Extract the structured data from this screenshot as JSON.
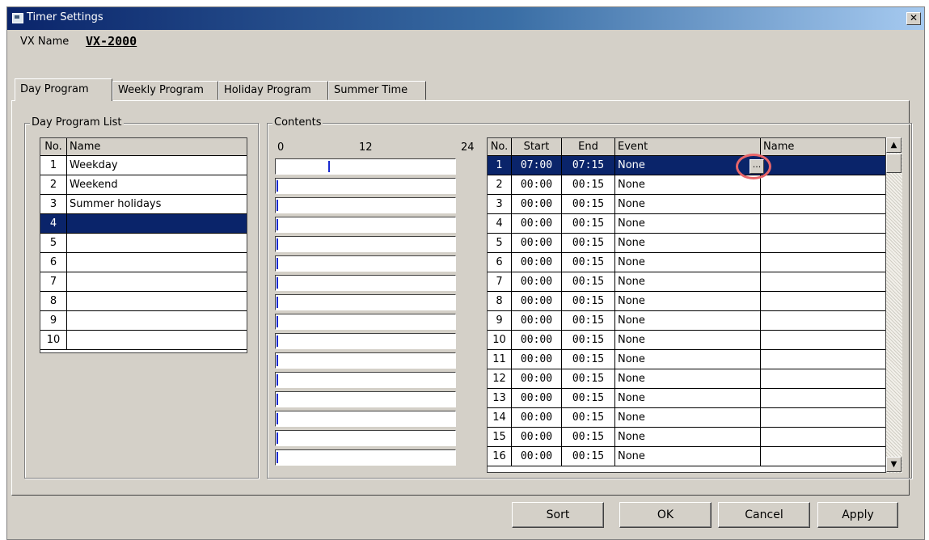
{
  "window": {
    "title": "Timer Settings"
  },
  "vx": {
    "label": "VX Name",
    "value": "VX-2000"
  },
  "tabs": [
    "Day Program",
    "Weekly Program",
    "Holiday Program",
    "Summer Time"
  ],
  "day_list": {
    "group_label": "Day Program List",
    "headers": {
      "no": "No.",
      "name": "Name"
    },
    "rows": [
      {
        "no": "1",
        "name": "Weekday"
      },
      {
        "no": "2",
        "name": "Weekend"
      },
      {
        "no": "3",
        "name": "Summer holidays"
      },
      {
        "no": "4",
        "name": ""
      },
      {
        "no": "5",
        "name": ""
      },
      {
        "no": "6",
        "name": ""
      },
      {
        "no": "7",
        "name": ""
      },
      {
        "no": "8",
        "name": ""
      },
      {
        "no": "9",
        "name": ""
      },
      {
        "no": "10",
        "name": ""
      }
    ],
    "selected_index": 3
  },
  "contents": {
    "group_label": "Contents",
    "scale": [
      "0",
      "12",
      "24"
    ],
    "bars": [
      {
        "start_hours": 7.0
      },
      {
        "start_hours": 0
      },
      {
        "start_hours": 0
      },
      {
        "start_hours": 0
      },
      {
        "start_hours": 0
      },
      {
        "start_hours": 0
      },
      {
        "start_hours": 0
      },
      {
        "start_hours": 0
      },
      {
        "start_hours": 0
      },
      {
        "start_hours": 0
      },
      {
        "start_hours": 0
      },
      {
        "start_hours": 0
      },
      {
        "start_hours": 0
      },
      {
        "start_hours": 0
      },
      {
        "start_hours": 0
      },
      {
        "start_hours": 0
      }
    ]
  },
  "events": {
    "headers": {
      "no": "No.",
      "start": "Start",
      "end": "End",
      "event": "Event",
      "name": "Name"
    },
    "ellipsis": "...",
    "rows": [
      {
        "no": "1",
        "start": "07:00",
        "end": "07:15",
        "event": "None",
        "name": ""
      },
      {
        "no": "2",
        "start": "00:00",
        "end": "00:15",
        "event": "None",
        "name": ""
      },
      {
        "no": "3",
        "start": "00:00",
        "end": "00:15",
        "event": "None",
        "name": ""
      },
      {
        "no": "4",
        "start": "00:00",
        "end": "00:15",
        "event": "None",
        "name": ""
      },
      {
        "no": "5",
        "start": "00:00",
        "end": "00:15",
        "event": "None",
        "name": ""
      },
      {
        "no": "6",
        "start": "00:00",
        "end": "00:15",
        "event": "None",
        "name": ""
      },
      {
        "no": "7",
        "start": "00:00",
        "end": "00:15",
        "event": "None",
        "name": ""
      },
      {
        "no": "8",
        "start": "00:00",
        "end": "00:15",
        "event": "None",
        "name": ""
      },
      {
        "no": "9",
        "start": "00:00",
        "end": "00:15",
        "event": "None",
        "name": ""
      },
      {
        "no": "10",
        "start": "00:00",
        "end": "00:15",
        "event": "None",
        "name": ""
      },
      {
        "no": "11",
        "start": "00:00",
        "end": "00:15",
        "event": "None",
        "name": ""
      },
      {
        "no": "12",
        "start": "00:00",
        "end": "00:15",
        "event": "None",
        "name": ""
      },
      {
        "no": "13",
        "start": "00:00",
        "end": "00:15",
        "event": "None",
        "name": ""
      },
      {
        "no": "14",
        "start": "00:00",
        "end": "00:15",
        "event": "None",
        "name": ""
      },
      {
        "no": "15",
        "start": "00:00",
        "end": "00:15",
        "event": "None",
        "name": ""
      },
      {
        "no": "16",
        "start": "00:00",
        "end": "00:15",
        "event": "None",
        "name": ""
      }
    ],
    "selected_index": 0
  },
  "buttons": {
    "sort": "Sort",
    "ok": "OK",
    "cancel": "Cancel",
    "apply": "Apply"
  },
  "colors": {
    "selection": "#0a246a",
    "timeline_marker": "#1a2bd0",
    "highlight_ring": "#e8666a",
    "face": "#d4d0c8"
  }
}
